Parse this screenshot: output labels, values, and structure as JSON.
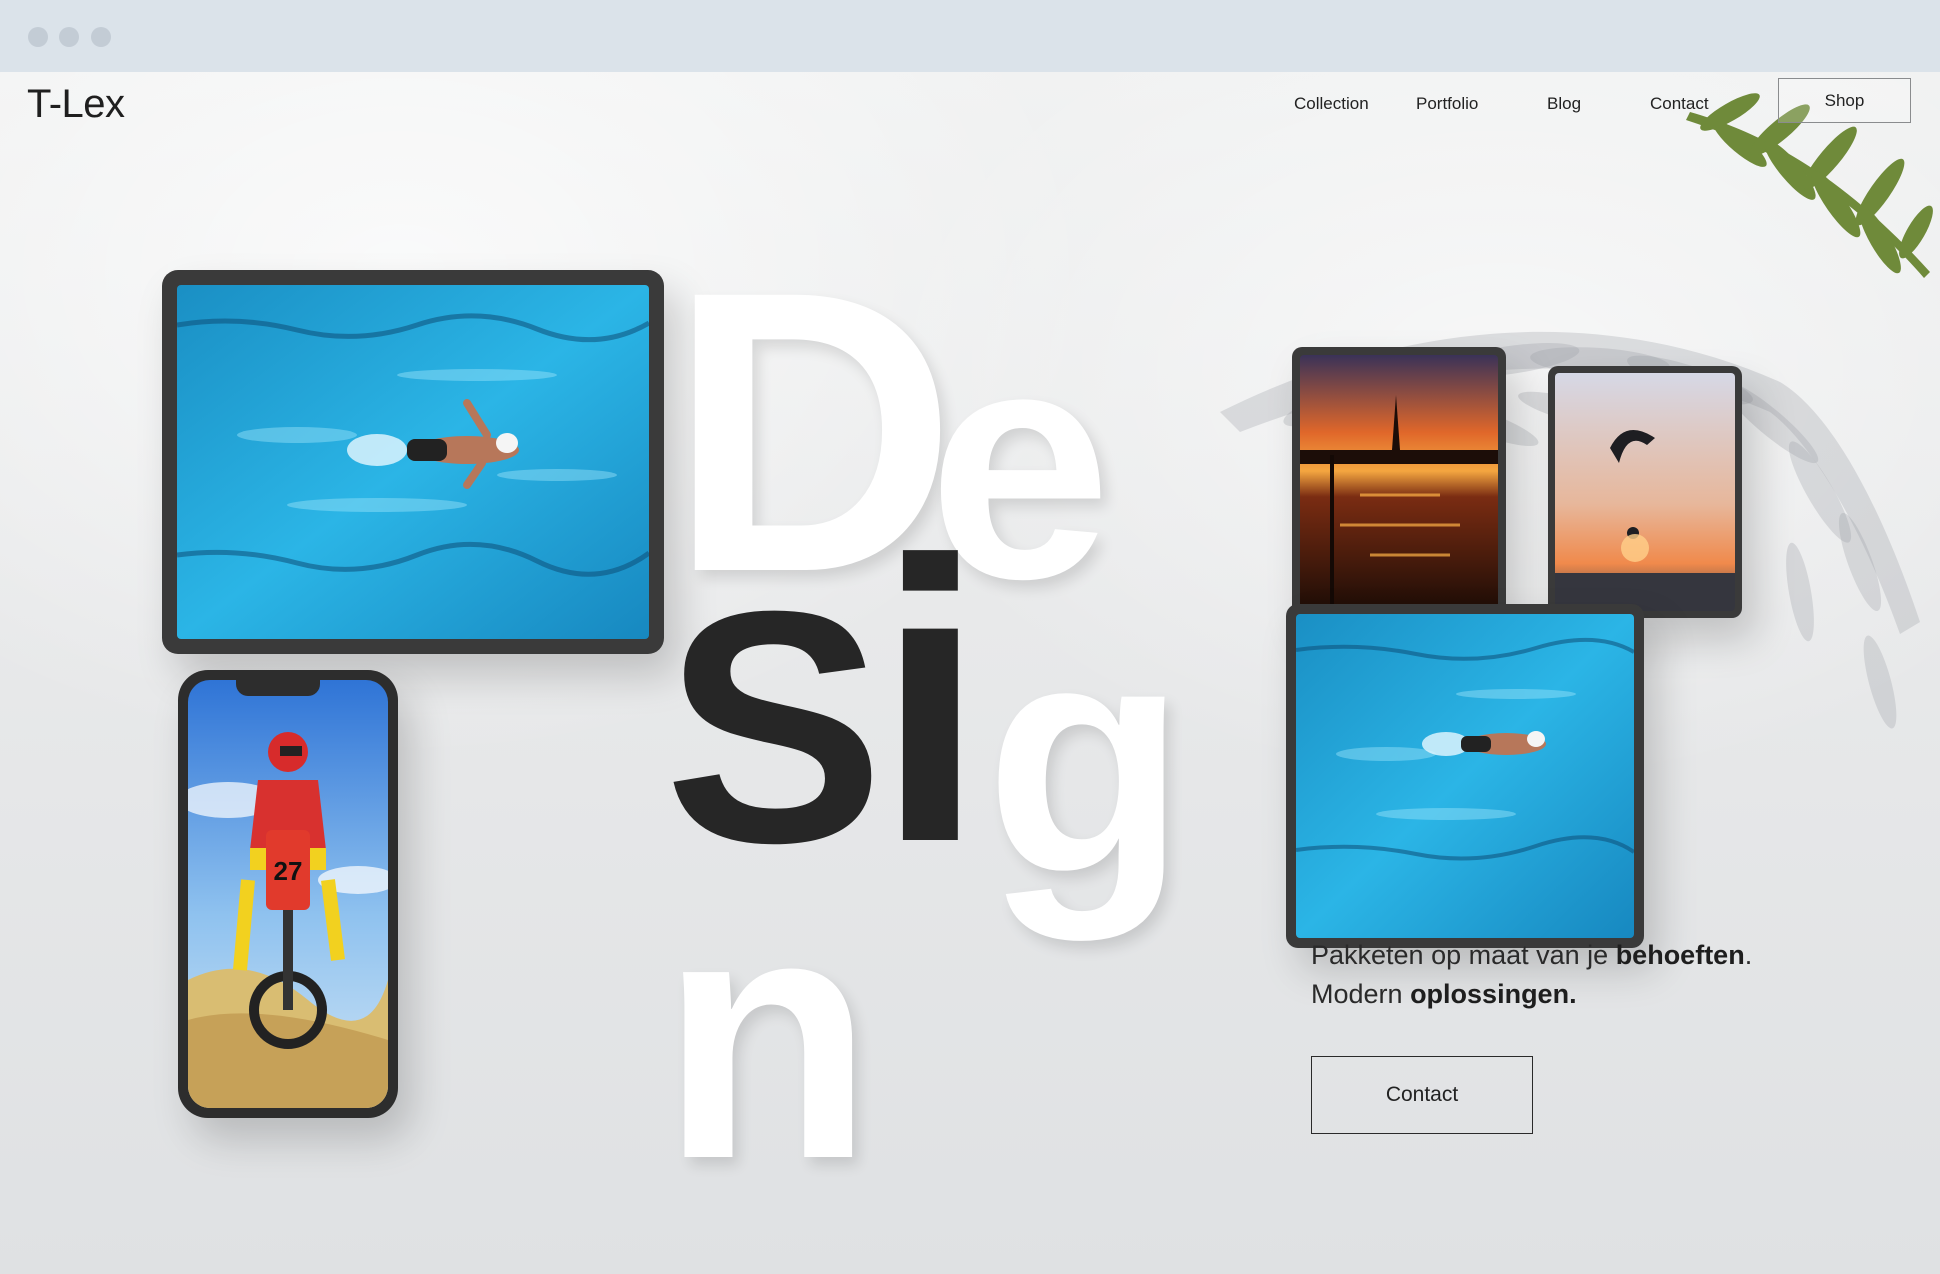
{
  "window": {
    "controls": [
      "close",
      "minimize",
      "maximize"
    ]
  },
  "header": {
    "logo": "T-Lex",
    "nav": [
      "Collection",
      "Portfolio",
      "Blog",
      "Contact"
    ],
    "shop_label": "Shop"
  },
  "hero": {
    "letters": {
      "l1": "D",
      "l2": "e",
      "l3": "S",
      "l4": "i",
      "l5": "g",
      "l6": "n"
    },
    "tagline_line1_prefix": "Pakketen op maat van je ",
    "tagline_line1_bold": "behoeften",
    "tagline_line1_suffix": ".",
    "tagline_line2_prefix": "Modern ",
    "tagline_line2_bold": "oplossingen.",
    "cta_label": "Contact"
  },
  "images": {
    "tablet_large": "swimmer-pool-photo",
    "phone": "motocross-rider-photo",
    "tablet_sunset": "sunset-lake-photo",
    "tablet_paraglider": "paraglider-sunset-photo",
    "tablet_small_swimmer": "swimmer-pool-photo"
  },
  "colors": {
    "chrome": "#dbe3ea",
    "text_dark": "#262626",
    "letters_white": "#ffffff",
    "pool": "#1ea7d8"
  }
}
